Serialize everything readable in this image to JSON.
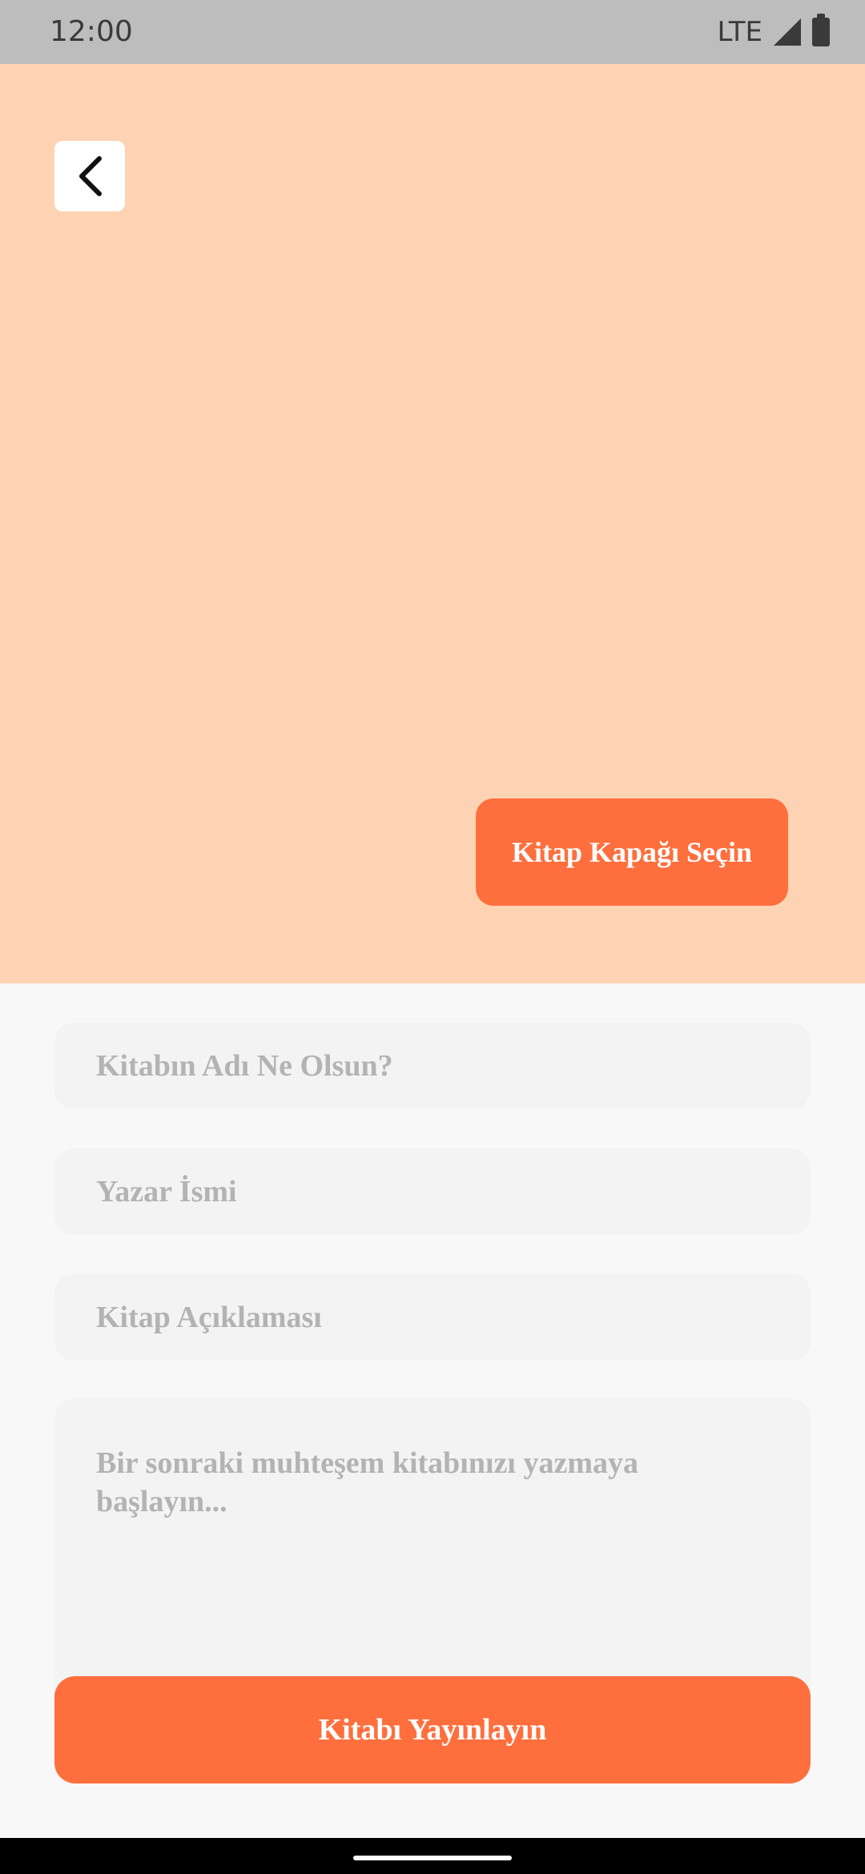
{
  "status_bar": {
    "time": "12:00",
    "network": "LTE"
  },
  "cover": {
    "background_color": "#FED3B4",
    "choose_cover_label": "Kitap Kapağı Seçin"
  },
  "form": {
    "title_placeholder": "Kitabın Adı Ne Olsun?",
    "author_placeholder": "Yazar İsmi",
    "description_placeholder": "Kitap Açıklaması",
    "content_placeholder": "Bir sonraki muhteşem kitabınızı yazmaya başlayın..."
  },
  "actions": {
    "publish_label": "Kitabı Yayınlayın"
  },
  "colors": {
    "accent": "#FF6F3E",
    "field_background": "#F3F3F3",
    "placeholder_text": "#B3B3B3"
  }
}
